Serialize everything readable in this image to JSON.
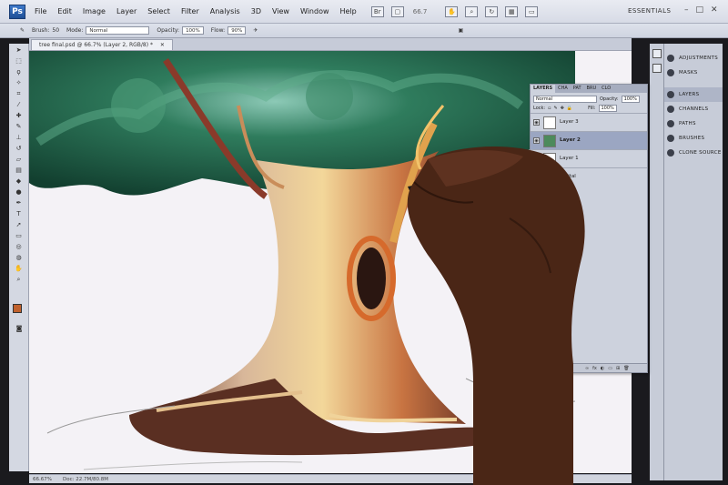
{
  "menubar": {
    "logo": "Ps",
    "items": [
      "File",
      "Edit",
      "Image",
      "Layer",
      "Select",
      "Filter",
      "Analysis",
      "3D",
      "View",
      "Window",
      "Help"
    ],
    "zoom": "66.7",
    "workspace": "ESSENTIALS"
  },
  "options": {
    "brush_label": "Brush:",
    "brush_size": "50",
    "mode_label": "Mode:",
    "mode_value": "Normal",
    "opacity_label": "Opacity:",
    "opacity_value": "100%",
    "flow_label": "Flow:",
    "flow_value": "90%"
  },
  "document": {
    "tab_title": "tree final.psd @ 66.7% (Layer 2, RGB/8) *"
  },
  "status": {
    "zoom": "66.67%",
    "doc": "Doc: 22.7M/80.8M"
  },
  "dock": {
    "items": [
      {
        "label": "ADJUSTMENTS",
        "active": false
      },
      {
        "label": "MASKS",
        "active": false
      },
      {
        "label": "LAYERS",
        "active": true
      },
      {
        "label": "CHANNELS",
        "active": false
      },
      {
        "label": "PATHS",
        "active": false
      },
      {
        "label": "BRUSHES",
        "active": false
      },
      {
        "label": "CLONE SOURCE",
        "active": false
      }
    ]
  },
  "layers_panel": {
    "tabs": [
      "LAYERS",
      "CHA",
      "PAT",
      "BRU",
      "CLO"
    ],
    "blend_mode": "Normal",
    "opacity_label": "Opacity:",
    "opacity_value": "100%",
    "lock_label": "Lock:",
    "fill_label": "Fill:",
    "fill_value": "100%",
    "layers": [
      {
        "name": "Layer 3",
        "selected": false
      },
      {
        "name": "Layer 2",
        "selected": true
      },
      {
        "name": "Layer 1",
        "selected": false
      },
      {
        "name": "Digital",
        "selected": false
      }
    ]
  },
  "colors": {
    "foreground": "#c0612d",
    "canopy": "#2f6f52",
    "trunk": "#a9654a"
  }
}
